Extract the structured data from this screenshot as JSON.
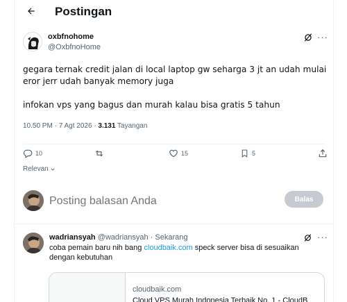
{
  "header": {
    "back_icon": "arrow-left-icon",
    "title": "Postingan"
  },
  "post": {
    "name": "oxbfnohome",
    "handle": "@OxbfnoHome",
    "body_line1": "gegara ternak credit jalan di local laptop gw seharga 3 jt an udah mulai eror jerr udah banyak memory juga",
    "body_line2": "infokan vps yang bagus dan murah kalau bisa gratis 5 tahun",
    "time": "10.50 PM · 7 Agt 2026 · ",
    "views_count": "3.131",
    "views_label": " Tayangan",
    "actions": {
      "replies": "10",
      "reposts": "",
      "likes": "15",
      "bookmarks": "5"
    },
    "sort_label": "Relevan"
  },
  "composer": {
    "placeholder": "Posting balasan Anda",
    "button_label": "Balas"
  },
  "reply": {
    "name": "wadriansyah",
    "handle": " @wadriansyah · Sekarang",
    "text_before": "coba pemain baru nih bang ",
    "link": "cloudbaik.com",
    "text_after": " speck server bisa di sesuaikan dengan kebutuhan",
    "card_domain": "cloudbaik.com",
    "card_title": "Cloud VPS Murah Indonesia Terbaik No. 1 - CloudB"
  },
  "colors": {
    "accent": "#1d9bf0",
    "muted": "#536471",
    "button_disabled": "#c5cbd0"
  }
}
